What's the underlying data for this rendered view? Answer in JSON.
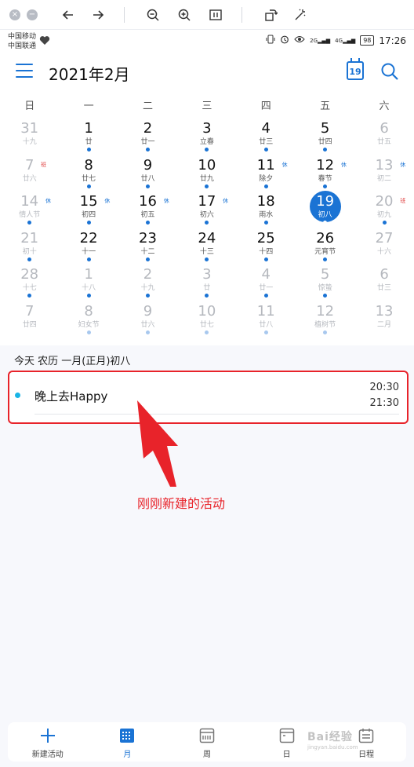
{
  "status": {
    "carrier1": "中国移动",
    "carrier2": "中国联通",
    "net1": "2G",
    "net2": "4G",
    "battery": "98",
    "time": "17:26"
  },
  "header": {
    "title": "2021年2月",
    "today_day": "19"
  },
  "calendar": {
    "weekdays": [
      "日",
      "一",
      "二",
      "三",
      "四",
      "五",
      "六"
    ],
    "weeks": [
      [
        {
          "d": "31",
          "l": "十九",
          "dim": true,
          "dot": ""
        },
        {
          "d": "1",
          "l": "廿",
          "dot": "b"
        },
        {
          "d": "2",
          "l": "廿一",
          "dot": "b"
        },
        {
          "d": "3",
          "l": "立春",
          "dot": "b"
        },
        {
          "d": "4",
          "l": "廿三",
          "dot": "b"
        },
        {
          "d": "5",
          "l": "廿四",
          "dot": "b"
        },
        {
          "d": "6",
          "l": "廿五",
          "dim": true,
          "dot": ""
        }
      ],
      [
        {
          "d": "7",
          "l": "廿六",
          "dim": true,
          "badge": "班",
          "badgeRed": true,
          "dot": ""
        },
        {
          "d": "8",
          "l": "廿七",
          "dot": "b"
        },
        {
          "d": "9",
          "l": "廿八",
          "dot": "b"
        },
        {
          "d": "10",
          "l": "廿九",
          "dot": "b"
        },
        {
          "d": "11",
          "l": "除夕",
          "badge": "休",
          "dot": "b"
        },
        {
          "d": "12",
          "l": "春节",
          "badge": "休",
          "dot": "b"
        },
        {
          "d": "13",
          "l": "初二",
          "dim": true,
          "badge": "休",
          "dot": ""
        }
      ],
      [
        {
          "d": "14",
          "l": "情人节",
          "dim": true,
          "badge": "休",
          "dot": "b"
        },
        {
          "d": "15",
          "l": "初四",
          "badge": "休",
          "dot": "b"
        },
        {
          "d": "16",
          "l": "初五",
          "badge": "休",
          "dot": "b"
        },
        {
          "d": "17",
          "l": "初六",
          "badge": "休",
          "dot": "b"
        },
        {
          "d": "18",
          "l": "雨水",
          "dot": "b"
        },
        {
          "d": "19",
          "l": "初八",
          "today": true,
          "dot": "w"
        },
        {
          "d": "20",
          "l": "初九",
          "dim": true,
          "badge": "班",
          "badgeRed": true,
          "dot": "b"
        }
      ],
      [
        {
          "d": "21",
          "l": "初十",
          "dim": true,
          "dot": "b"
        },
        {
          "d": "22",
          "l": "十一",
          "dot": "b"
        },
        {
          "d": "23",
          "l": "十二",
          "dot": "b"
        },
        {
          "d": "24",
          "l": "十三",
          "dot": "b"
        },
        {
          "d": "25",
          "l": "十四",
          "dot": "b"
        },
        {
          "d": "26",
          "l": "元宵节",
          "dot": "b"
        },
        {
          "d": "27",
          "l": "十六",
          "dim": true,
          "dot": ""
        }
      ],
      [
        {
          "d": "28",
          "l": "十七",
          "dim": true,
          "dot": "b"
        },
        {
          "d": "1",
          "l": "十八",
          "dim": true,
          "dot": "b"
        },
        {
          "d": "2",
          "l": "十九",
          "dim": true,
          "dot": "b"
        },
        {
          "d": "3",
          "l": "廿",
          "dim": true,
          "dot": "b"
        },
        {
          "d": "4",
          "l": "廿一",
          "dim": true,
          "dot": "b"
        },
        {
          "d": "5",
          "l": "惊蛰",
          "dim": true,
          "dot": "b"
        },
        {
          "d": "6",
          "l": "廿三",
          "dim": true,
          "dot": ""
        }
      ],
      [
        {
          "d": "7",
          "l": "廿四",
          "dim": true,
          "dot": ""
        },
        {
          "d": "8",
          "l": "妇女节",
          "dim": true,
          "dot": "l"
        },
        {
          "d": "9",
          "l": "廿六",
          "dim": true,
          "dot": "l"
        },
        {
          "d": "10",
          "l": "廿七",
          "dim": true,
          "dot": "l"
        },
        {
          "d": "11",
          "l": "廿八",
          "dim": true,
          "dot": "l"
        },
        {
          "d": "12",
          "l": "植树节",
          "dim": true,
          "dot": "l"
        },
        {
          "d": "13",
          "l": "二月",
          "dim": true,
          "dot": ""
        }
      ]
    ]
  },
  "agenda": {
    "header": "今天  农历 一月(正月)初八",
    "event": {
      "title": "晚上去Happy",
      "start": "20:30",
      "end": "21:30"
    }
  },
  "annotation": "刚刚新建的活动",
  "nav": {
    "items": [
      {
        "label": "新建活动",
        "icon": "add-icon"
      },
      {
        "label": "月",
        "icon": "month-icon",
        "active": true
      },
      {
        "label": "周",
        "icon": "week-icon"
      },
      {
        "label": "日",
        "icon": "day-icon"
      },
      {
        "label": "日程",
        "icon": "agenda-icon"
      }
    ]
  },
  "watermark": {
    "brand": "Bai经验",
    "url": "jingyan.baidu.com"
  },
  "colors": {
    "accent": "#1a73d4",
    "highlight": "#e8232a",
    "event_dot": "#19b4e6"
  }
}
